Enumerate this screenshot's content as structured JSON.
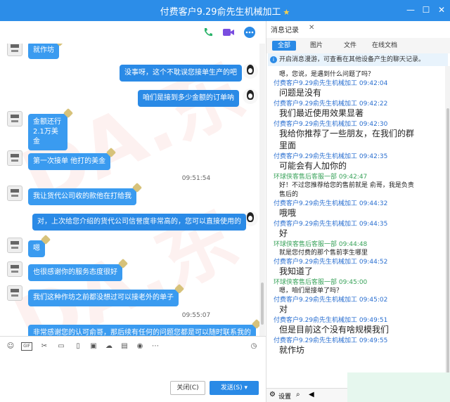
{
  "window": {
    "title": "付费客户9.29俞先生机械加工",
    "star": "★",
    "min": "—",
    "max": "☐",
    "close": "✕"
  },
  "chat": {
    "messages": [
      {
        "text": "就作坊"
      },
      {
        "text": "没事呀，这个不耽误您接单生产的吧"
      },
      {
        "text": "咱们是接到多少金额的订单呐"
      },
      {
        "text": "金额还行"
      },
      {
        "text": "2.1万美金"
      },
      {
        "text": "第一次接单 他打的美金"
      },
      {
        "text": "我让货代公司收的款他在打给我"
      },
      {
        "text": "对，上次给您介绍的货代公司信誉度非常高的，您可以直接使用的"
      },
      {
        "text": "嗯"
      },
      {
        "text": "也很感谢你的服务态度很好"
      },
      {
        "text": "我们这种作坊之前都没想过可以接老外的单子"
      },
      {
        "text": "非常感谢您的认可俞哥，那后续有任何的问题您都是可以随时联系我的"
      }
    ],
    "timestamps": [
      "09:51:54",
      "09:55:07"
    ]
  },
  "input": {
    "close_label": "关闭(C)",
    "send_label": "发送(S)",
    "send_arrow": "▾"
  },
  "history": {
    "tab_label": "消息记录",
    "tab_close": "✕",
    "filters": [
      "全部",
      "图片",
      "文件",
      "在线文档"
    ],
    "notice": "开启消息漫游，可查看在其他设备产生的聊天记录。",
    "entries": [
      {
        "head": "嗯，您说，是遇到什么问题了吗？",
        "kind": "small"
      },
      {
        "head": "付费客户9.29俞先生机械加工 09:42:04",
        "kind": "blue"
      },
      {
        "head": "问题是没有",
        "kind": "msg"
      },
      {
        "head": "付费客户9.29俞先生机械加工 09:42:22",
        "kind": "blue"
      },
      {
        "head": "我们最近使用效果显著",
        "kind": "msg"
      },
      {
        "head": "付费客户9.29俞先生机械加工 09:42:30",
        "kind": "blue"
      },
      {
        "head": "我给你推荐了一些朋友，在我们的群",
        "kind": "msg"
      },
      {
        "head": "里面",
        "kind": "msg"
      },
      {
        "head": "付费客户9.29俞先生机械加工 09:42:35",
        "kind": "blue"
      },
      {
        "head": "可能会有人加你的",
        "kind": "msg"
      },
      {
        "head": "环球侠客售后客服一部 09:42:47",
        "kind": "green"
      },
      {
        "head": "好！不过您推荐给您的售前就是 俞哥，我是负责",
        "kind": "small"
      },
      {
        "head": "售后的",
        "kind": "small"
      },
      {
        "head": "付费客户9.29俞先生机械加工 09:44:32",
        "kind": "blue"
      },
      {
        "head": "哦哦",
        "kind": "msg"
      },
      {
        "head": "付费客户9.29俞先生机械加工 09:44:35",
        "kind": "blue"
      },
      {
        "head": "好",
        "kind": "msg"
      },
      {
        "head": "环球侠客售后客服一部 09:44:48",
        "kind": "green"
      },
      {
        "head": "就是您付费的那个售前李生哪里",
        "kind": "small"
      },
      {
        "head": "付费客户9.29俞先生机械加工 09:44:52",
        "kind": "blue"
      },
      {
        "head": "我知道了",
        "kind": "msg"
      },
      {
        "head": "环球侠客售后客服一部 09:45:00",
        "kind": "green"
      },
      {
        "head": "嗯，咱们是接单了吗？",
        "kind": "small"
      },
      {
        "head": "付费客户9.29俞先生机械加工 09:45:02",
        "kind": "blue"
      },
      {
        "head": "对",
        "kind": "msg"
      },
      {
        "head": "付费客户9.29俞先生机械加工 09:49:51",
        "kind": "blue"
      },
      {
        "head": "但是目前这个没有啥规模我们",
        "kind": "msg"
      },
      {
        "head": "付费客户9.29俞先生机械加工 09:49:55",
        "kind": "blue"
      },
      {
        "head": "就作坊",
        "kind": "msg"
      }
    ],
    "settings_label": "设置"
  }
}
